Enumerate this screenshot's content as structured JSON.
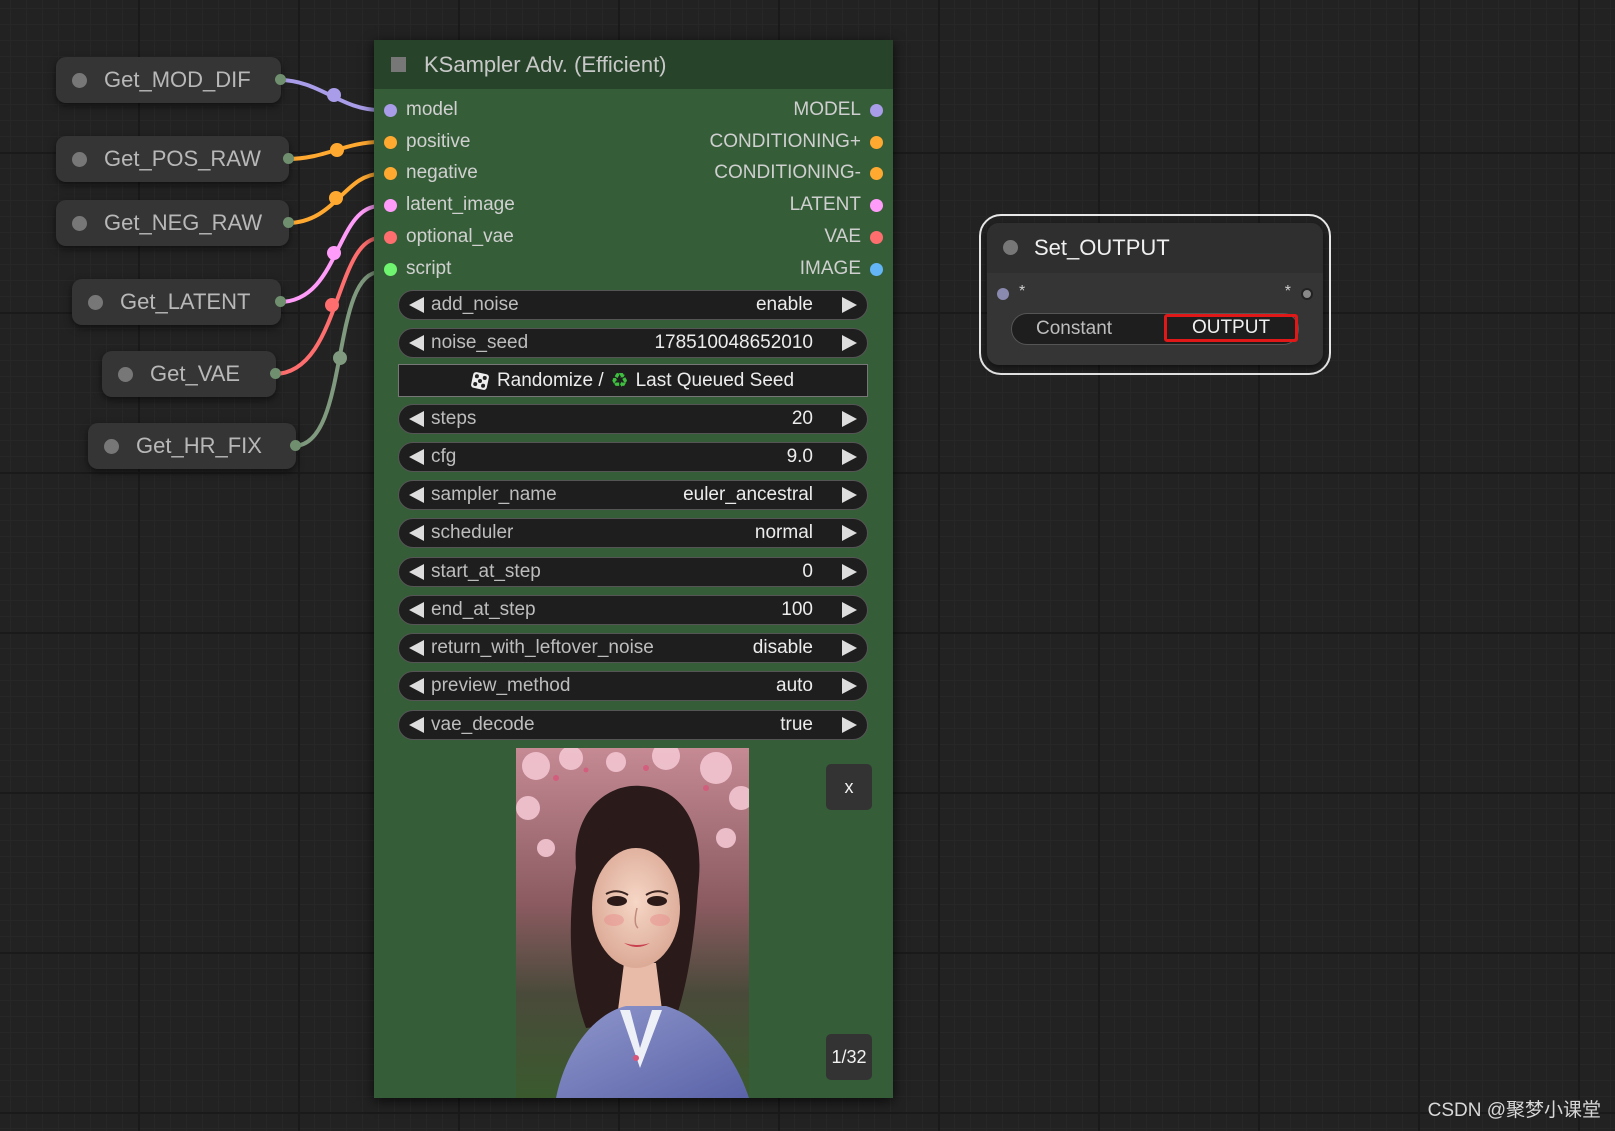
{
  "getters": [
    {
      "id": "mod-dif",
      "label": "Get_MOD_DIF"
    },
    {
      "id": "pos-raw",
      "label": "Get_POS_RAW"
    },
    {
      "id": "neg-raw",
      "label": "Get_NEG_RAW"
    },
    {
      "id": "latent",
      "label": "Get_LATENT"
    },
    {
      "id": "vae",
      "label": "Get_VAE"
    },
    {
      "id": "hr-fix",
      "label": "Get_HR_FIX"
    }
  ],
  "colors": {
    "model": "#a99ce8",
    "conditioning": "#ffa931",
    "latent": "#ff9cf9",
    "vae": "#ff6e6e",
    "script": "#6ff56f",
    "image": "#64b5f6",
    "hr_fix_wire": "#7f9a7f",
    "node_body": "#355e38",
    "node_title": "#27442a",
    "highlight": "#e01818"
  },
  "ksampler": {
    "title": "KSampler Adv. (Efficient)",
    "inputs": [
      {
        "name": "model",
        "type": "model"
      },
      {
        "name": "positive",
        "type": "conditioning"
      },
      {
        "name": "negative",
        "type": "conditioning"
      },
      {
        "name": "latent_image",
        "type": "latent"
      },
      {
        "name": "optional_vae",
        "type": "vae"
      },
      {
        "name": "script",
        "type": "script"
      }
    ],
    "outputs": [
      {
        "name": "MODEL",
        "type": "model"
      },
      {
        "name": "CONDITIONING+",
        "type": "conditioning"
      },
      {
        "name": "CONDITIONING-",
        "type": "conditioning"
      },
      {
        "name": "LATENT",
        "type": "latent"
      },
      {
        "name": "VAE",
        "type": "vae"
      },
      {
        "name": "IMAGE",
        "type": "image"
      }
    ],
    "widgets": [
      {
        "name": "add_noise",
        "value": "enable"
      },
      {
        "name": "noise_seed",
        "value": "178510048652010"
      },
      {
        "name": "steps",
        "value": "20"
      },
      {
        "name": "cfg",
        "value": "9.0"
      },
      {
        "name": "sampler_name",
        "value": "euler_ancestral"
      },
      {
        "name": "scheduler",
        "value": "normal"
      },
      {
        "name": "start_at_step",
        "value": "0"
      },
      {
        "name": "end_at_step",
        "value": "100"
      },
      {
        "name": "return_with_leftover_noise",
        "value": "disable"
      },
      {
        "name": "preview_method",
        "value": "auto"
      },
      {
        "name": "vae_decode",
        "value": "true"
      }
    ],
    "seed_button": {
      "randomize_label": "Randomize /",
      "last_seed_label": "Last Queued Seed",
      "left_icon": "die-icon",
      "right_icon": "recycle-icon"
    },
    "preview": {
      "close_label": "x",
      "counter": "1/32"
    }
  },
  "set_output": {
    "title": "Set_OUTPUT",
    "input_label": "*",
    "output_label": "*",
    "widget_name": "Constant",
    "widget_value": "OUTPUT"
  },
  "watermark": "CSDN @聚梦小课堂"
}
